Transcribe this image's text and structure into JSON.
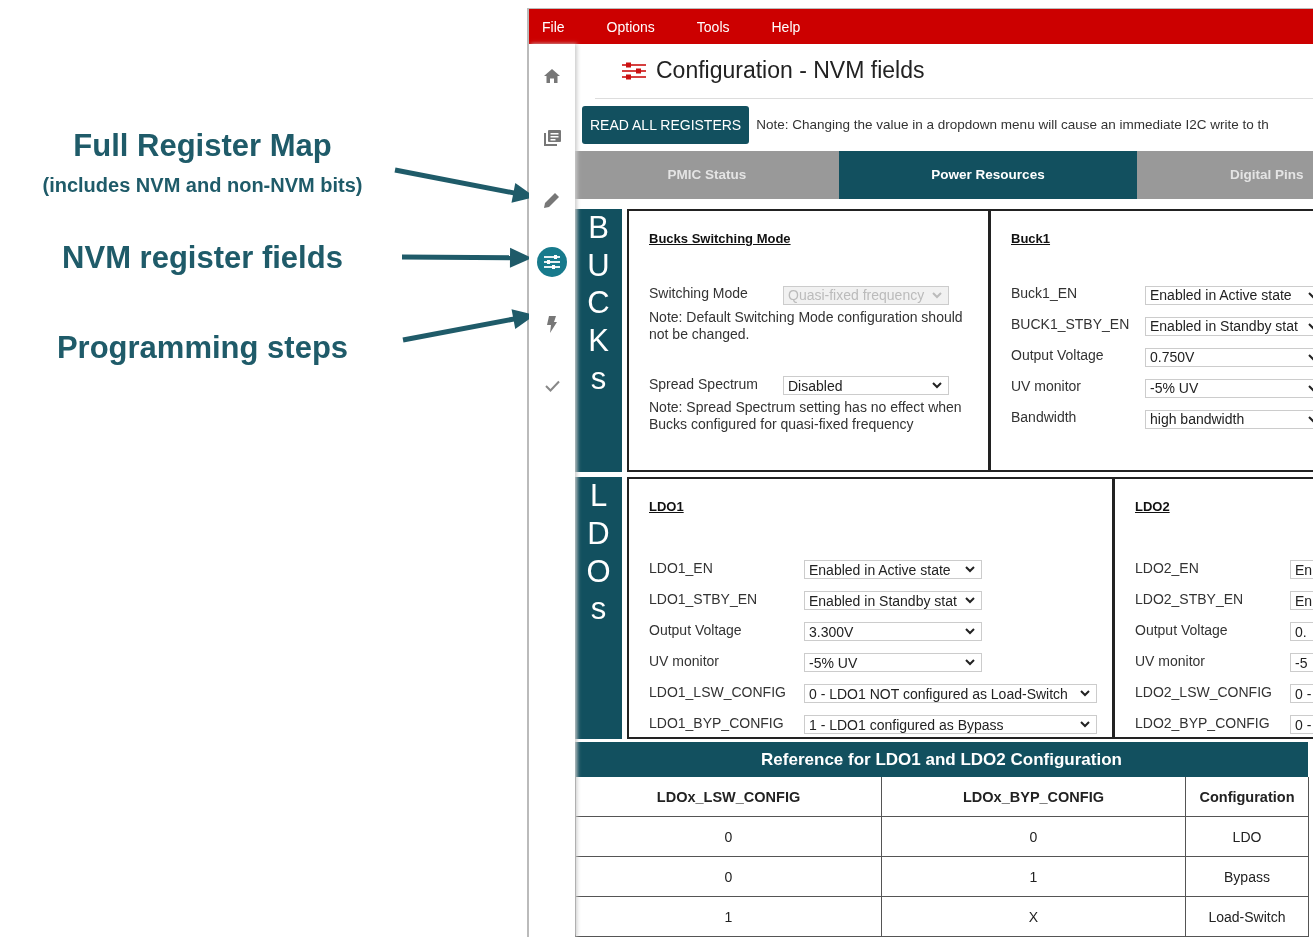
{
  "annotations": [
    {
      "title": "Full Register Map",
      "subtitle": "(includes NVM and non-NVM bits)"
    },
    {
      "title": "NVM register fields"
    },
    {
      "title": "Programming steps"
    }
  ],
  "menu": [
    "File",
    "Options",
    "Tools",
    "Help"
  ],
  "sidebar": [
    {
      "kind": "home",
      "selected": false
    },
    {
      "kind": "list",
      "selected": false
    },
    {
      "kind": "pencil",
      "selected": false
    },
    {
      "kind": "sliders",
      "selected": true
    },
    {
      "kind": "bolt",
      "selected": false
    },
    {
      "kind": "check",
      "selected": false
    }
  ],
  "page_title": "Configuration - NVM fields",
  "read_button": "READ ALL REGISTERS",
  "note": "Note: Changing the value in a dropdown menu will cause an immediate I2C write to th",
  "tabs": [
    {
      "label": "PMIC Status",
      "selected": false
    },
    {
      "label": "Power Resources",
      "selected": true
    },
    {
      "label": "Digital Pins",
      "selected": false
    }
  ],
  "sections": [
    {
      "label": "BUCKs",
      "panels": [
        {
          "title": "Bucks Switching Mode",
          "items": [
            {
              "kind": "select",
              "label": "Switching Mode",
              "value": "Quasi-fixed frequency",
              "disabled": true
            },
            {
              "kind": "note",
              "text": "Note: Default Switching Mode configuration should not be changed."
            },
            {
              "kind": "select",
              "label": "Spread Spectrum",
              "value": "Disabled",
              "disabled": false
            },
            {
              "kind": "note",
              "text": "Note: Spread Spectrum setting has no effect when Bucks configured for quasi-fixed frequency"
            }
          ]
        },
        {
          "title": "Buck1",
          "items": [
            {
              "kind": "select",
              "label": "Buck1_EN",
              "value": "Enabled in Active state",
              "disabled": false
            },
            {
              "kind": "select",
              "label": "BUCK1_STBY_EN",
              "value": "Enabled in Standby stat",
              "disabled": false
            },
            {
              "kind": "select",
              "label": "Output Voltage",
              "value": "0.750V",
              "disabled": false
            },
            {
              "kind": "select",
              "label": "UV monitor",
              "value": "-5% UV",
              "disabled": false
            },
            {
              "kind": "select",
              "label": "Bandwidth",
              "value": "high bandwidth",
              "disabled": false
            }
          ]
        }
      ]
    },
    {
      "label": "LDOs",
      "panels": [
        {
          "title": "LDO1",
          "items": [
            {
              "kind": "select",
              "label": "LDO1_EN",
              "value": "Enabled in Active state",
              "disabled": false
            },
            {
              "kind": "select",
              "label": "LDO1_STBY_EN",
              "value": "Enabled in Standby stat",
              "disabled": false
            },
            {
              "kind": "select",
              "label": "Output Voltage",
              "value": "3.300V",
              "disabled": false
            },
            {
              "kind": "select",
              "label": "UV monitor",
              "value": "-5% UV",
              "disabled": false
            },
            {
              "kind": "wide-select",
              "label": "LDO1_LSW_CONFIG",
              "value": "0 - LDO1 NOT configured as Load-Switch",
              "disabled": false
            },
            {
              "kind": "wide-select",
              "label": "LDO1_BYP_CONFIG",
              "value": "1 - LDO1 configured as Bypass",
              "disabled": false
            }
          ]
        },
        {
          "title": "LDO2",
          "items": [
            {
              "kind": "select",
              "label": "LDO2_EN",
              "value": "En",
              "disabled": false
            },
            {
              "kind": "select",
              "label": "LDO2_STBY_EN",
              "value": "En",
              "disabled": false
            },
            {
              "kind": "select",
              "label": "Output Voltage",
              "value": "0.",
              "disabled": false
            },
            {
              "kind": "select",
              "label": "UV monitor",
              "value": "-5",
              "disabled": false
            },
            {
              "kind": "select",
              "label": "LDO2_LSW_CONFIG",
              "value": "0 -",
              "disabled": false
            },
            {
              "kind": "select",
              "label": "LDO2_BYP_CONFIG",
              "value": "0 -",
              "disabled": false
            }
          ]
        }
      ]
    }
  ],
  "reference": {
    "title": "Reference for LDO1 and LDO2 Configuration",
    "columns": [
      "LDOx_LSW_CONFIG",
      "LDOx_BYP_CONFIG",
      "Configuration"
    ],
    "rows": [
      [
        "0",
        "0",
        "LDO"
      ],
      [
        "0",
        "1",
        "Bypass"
      ],
      [
        "1",
        "X",
        "Load-Switch"
      ]
    ]
  }
}
